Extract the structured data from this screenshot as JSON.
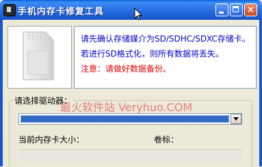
{
  "window": {
    "title": "手机内存卡修复工具",
    "buttons": {
      "close": "×"
    }
  },
  "info": {
    "line1": "请先确认存储媒介为SD/SDHC/SDXC存储卡。",
    "line2": "若进行SD格式化，则所有数据将丢失。",
    "line3": "注意：请做好数据备份。",
    "line_color": "#0000CC",
    "warning_color": "#E00000"
  },
  "drive": {
    "label": "请选择驱动器：",
    "selected": ""
  },
  "watermark": "最火软件站 Veryhuo.COM",
  "card_size": {
    "label": "当前内存卡大小："
  },
  "volume": {
    "label": "卷标："
  },
  "icons": [
    "app-icon",
    "cursor-icon",
    "sd-card-icon",
    "chevron-down-icon"
  ]
}
